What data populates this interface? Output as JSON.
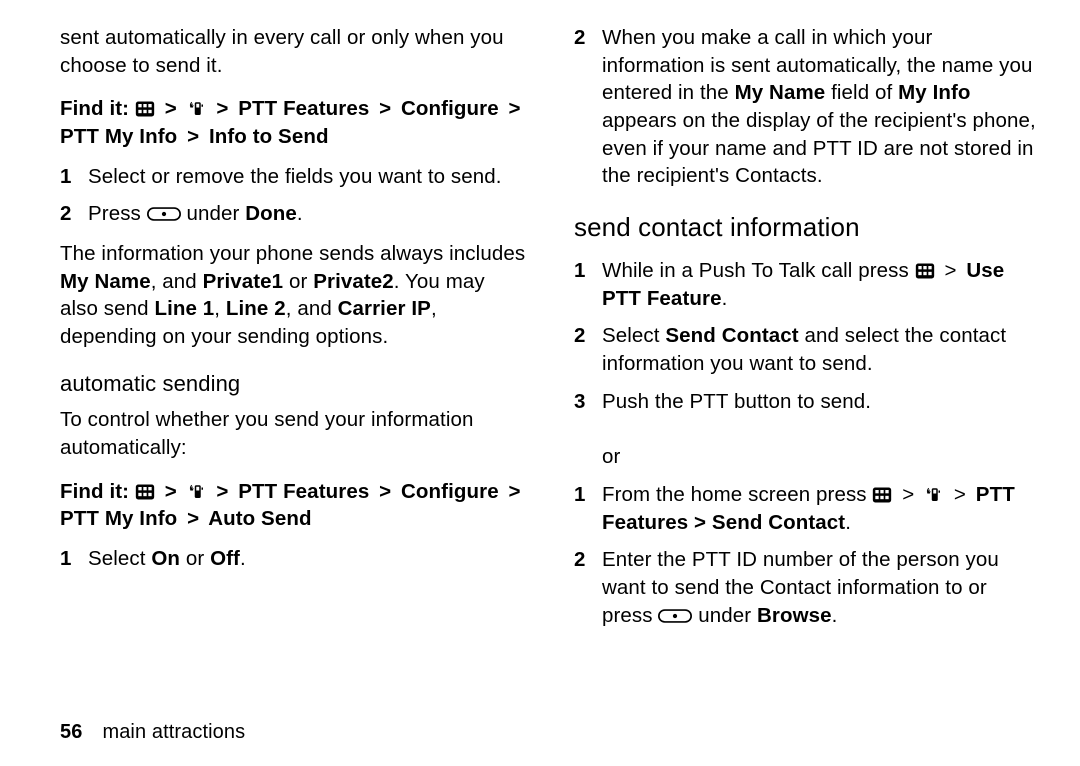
{
  "page_number": "56",
  "page_section": "main attractions",
  "col1": {
    "intro": "sent automatically in every call or only when you choose to send it.",
    "findit_label": "Find it:",
    "path_ptt_features": "PTT Features",
    "path_configure": "Configure",
    "path_ptt_my_info": "PTT My Info",
    "path_info_to_send": "Info to Send",
    "step1_num": "1",
    "step1": "Select or remove the fields you want to send.",
    "step2_num": "2",
    "step2_a": "Press ",
    "step2_b": " under ",
    "step2_done": "Done",
    "step2_c": ".",
    "para2_a": "The information your phone sends always includes ",
    "my_name": "My Name",
    "para2_b": ", and ",
    "private1": "Private1",
    "para2_c": " or ",
    "private2": "Private2",
    "para2_d": ". You may also send ",
    "line1": "Line 1",
    "para2_e": ", ",
    "line2": "Line 2",
    "para2_f": ", and ",
    "carrier_ip": "Carrier IP",
    "para2_g": ", depending on your sending options.",
    "auto_heading": "automatic sending",
    "auto_intro": "To control whether you send your information automatically:",
    "path_auto_send": "Auto Send",
    "auto_step1_num": "1",
    "auto_step1_a": "Select ",
    "on": "On",
    "auto_step1_b": " or ",
    "off": "Off",
    "auto_step1_c": "."
  },
  "col2": {
    "step2top_num": "2",
    "step2top_a": "When you make a call in which your information is sent automatically, the name you entered in the ",
    "my_name": "My Name",
    "step2top_b": " field of ",
    "my_info": "My Info",
    "step2top_c": " appears on the display of the recipient's phone, even if your name and PTT ID are not stored in the recipient's Contacts.",
    "heading": "send contact information",
    "s1_num": "1",
    "s1_a": "While in a Push To Talk call press ",
    "s1_use": "Use PTT Feature",
    "s1_b": ".",
    "s2_num": "2",
    "s2_a": "Select ",
    "s2_send_contact": "Send Contact",
    "s2_b": " and select the contact information you want to send.",
    "s3_num": "3",
    "s3": "Push the PTT button to send.",
    "s3_or": "or",
    "s4_num": "1",
    "s4_a": "From the home screen press ",
    "s4_path": "PTT Features > Send Contact",
    "s4_b": ".",
    "s5_num": "2",
    "s5_a": "Enter the PTT ID number of the person you want to send the Contact information to or press ",
    "s5_b": " under ",
    "s5_browse": "Browse",
    "s5_c": "."
  },
  "gt": ">"
}
